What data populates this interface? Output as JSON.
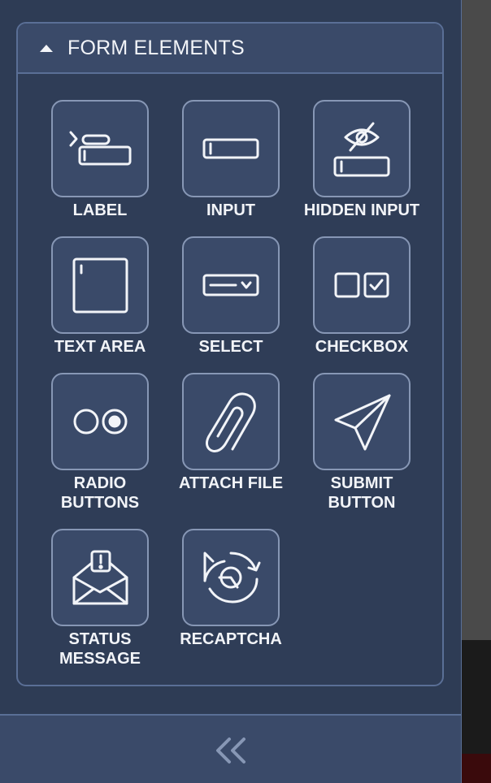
{
  "section": {
    "title": "FORM ELEMENTS",
    "expanded": true
  },
  "items": [
    {
      "label": "LABEL",
      "icon": "label-icon"
    },
    {
      "label": "INPUT",
      "icon": "input-icon"
    },
    {
      "label": "HIDDEN INPUT",
      "icon": "hidden-input-icon"
    },
    {
      "label": "TEXT AREA",
      "icon": "text-area-icon"
    },
    {
      "label": "SELECT",
      "icon": "select-icon"
    },
    {
      "label": "CHECKBOX",
      "icon": "checkbox-icon"
    },
    {
      "label_line1": "RADIO",
      "label_line2": "BUTTONS",
      "icon": "radio-buttons-icon"
    },
    {
      "label": "ATTACH FILE",
      "icon": "paperclip-icon"
    },
    {
      "label_line1": "SUBMIT",
      "label_line2": "BUTTON",
      "icon": "paper-plane-icon"
    },
    {
      "label_line1": "STATUS",
      "label_line2": "MESSAGE",
      "icon": "envelope-alert-icon"
    },
    {
      "label": "RECAPTCHA",
      "icon": "recaptcha-icon"
    }
  ],
  "footer": {
    "collapse_icon": "double-chevron-left-icon"
  },
  "colors": {
    "panel": "#2e3c55",
    "tile": "#3a4a69",
    "border": "#5a6f96",
    "text": "#f2f4f8"
  }
}
